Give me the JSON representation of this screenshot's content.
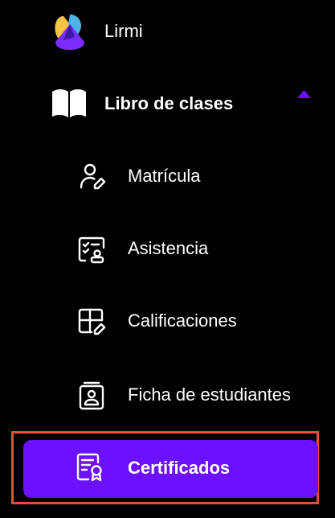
{
  "brand": {
    "name": "Lirmi",
    "logo_colors": [
      "#f5c542",
      "#4fb3e8",
      "#7a2cff",
      "#3d1aa0"
    ]
  },
  "menu": {
    "section": {
      "label": "Libro de clases",
      "icon": "open-book-icon",
      "expanded": true,
      "chevron_icon": "chevron-up-icon",
      "chevron_color": "#6c11ff"
    },
    "items": [
      {
        "label": "Matrícula",
        "icon": "user-edit-icon",
        "active": false
      },
      {
        "label": "Asistencia",
        "icon": "attendance-checklist-icon",
        "active": false
      },
      {
        "label": "Calificaciones",
        "icon": "grid-edit-icon",
        "active": false
      },
      {
        "label": "Ficha de estudiantes",
        "icon": "student-card-icon",
        "active": false
      },
      {
        "label": "Certificados",
        "icon": "certificate-icon",
        "active": true
      }
    ]
  },
  "colors": {
    "background": "#000000",
    "active_background": "#6c11ff",
    "highlight_border": "#e74c3c",
    "text": "#ffffff"
  }
}
